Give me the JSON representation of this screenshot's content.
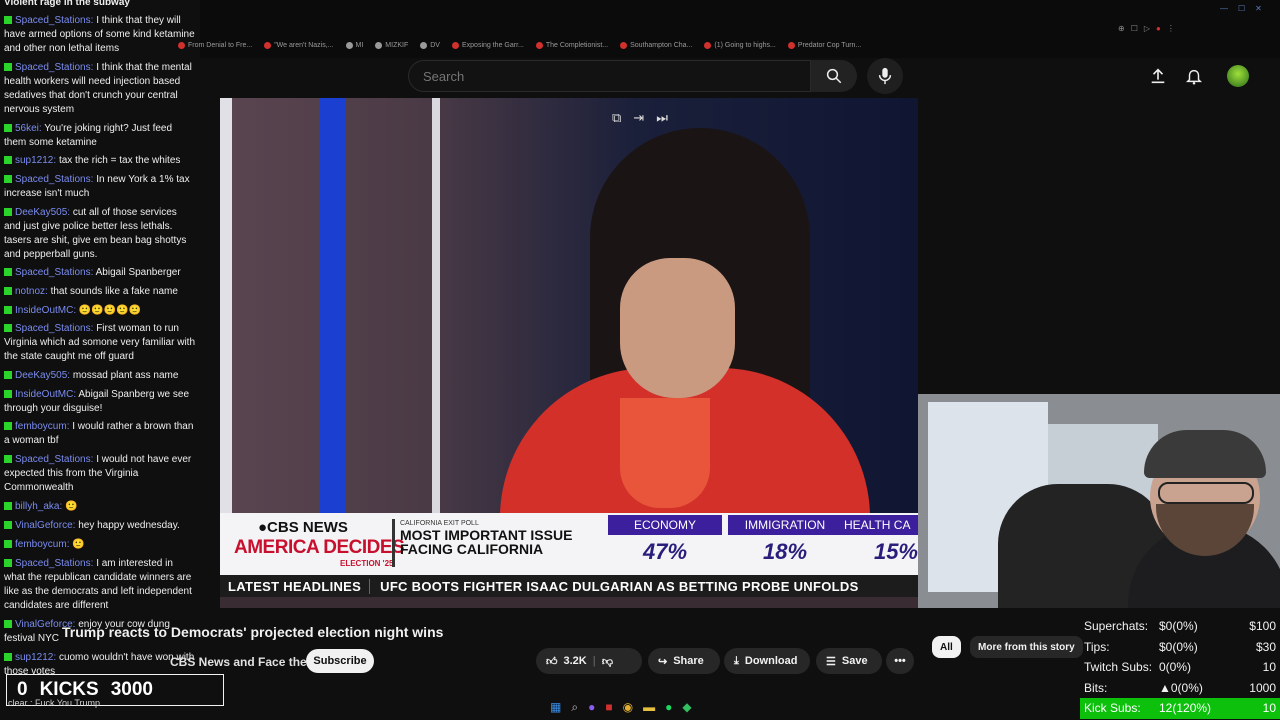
{
  "browser": {
    "bookmarks": [
      {
        "label": "From Denial to Fre...",
        "color": "#d0312d"
      },
      {
        "label": "\"We aren't Nazis,...",
        "color": "#d0312d"
      },
      {
        "label": "MI",
        "color": "#9a9a9a"
      },
      {
        "label": "MIZKIF",
        "color": "#9a9a9a"
      },
      {
        "label": "DV",
        "color": "#9a9a9a"
      },
      {
        "label": "Exposing the Garr...",
        "color": "#d0312d"
      },
      {
        "label": "The Completionist...",
        "color": "#d0312d"
      },
      {
        "label": "Southampton Cha...",
        "color": "#d0312d"
      },
      {
        "label": "(1) Going to highs...",
        "color": "#d0312d"
      },
      {
        "label": "Predator Cop Turn...",
        "color": "#d0312d"
      }
    ]
  },
  "header": {
    "search_placeholder": "Search",
    "icons": [
      "search-icon",
      "mic-icon",
      "upload-icon",
      "bell-icon",
      "avatar"
    ]
  },
  "video": {
    "overlay_controls": [
      "⧉",
      "⇥",
      "⏭"
    ],
    "cbs_logo": "●CBS NEWS",
    "america_decides": "AMERICA DECIDES",
    "election_tag": "ELECTION '25",
    "poll_label": "CALIFORNIA EXIT POLL",
    "poll_title": "MOST IMPORTANT ISSUE FACING CALIFORNIA",
    "poll": [
      {
        "category": "ECONOMY",
        "value": "47%"
      },
      {
        "category": "IMMIGRATION",
        "value": "18%"
      },
      {
        "category": "HEALTH CA",
        "value": "15%"
      }
    ],
    "ticker_label": "LATEST HEADLINES",
    "ticker_text": "UFC BOOTS FIGHTER ISAAC DULGARIAN AS BETTING PROBE UNFOLDS"
  },
  "meta": {
    "title": "Trump reacts to Democrats' projected election night wins",
    "channel": "CBS News and Face the Nation",
    "subscribe": "Subscribe",
    "likes": "3.2K",
    "share": "Share",
    "download": "Download",
    "save": "Save",
    "more": "•••",
    "chips": [
      "All",
      "More from this story"
    ]
  },
  "stats": [
    {
      "name": "Superchats:",
      "mid": "$0(0%)",
      "val": "$100"
    },
    {
      "name": "Tips:",
      "mid": "$0(0%)",
      "val": "$30"
    },
    {
      "name": "Twitch Subs:",
      "mid": "0(0%)",
      "val": "10"
    },
    {
      "name": "Bits:",
      "mid": "▲0(0%)",
      "val": "1000"
    },
    {
      "name": "Kick Subs:",
      "mid": "12(120%)",
      "val": "10"
    }
  ],
  "chat": {
    "top_line": "Violent rage in the subway",
    "messages": [
      {
        "user": "Spaced_Stations",
        "text": "I think that they will have armed options of some kind ketamine and other non lethal items"
      },
      {
        "user": "Spaced_Stations",
        "text": "I think that the mental health workers will need injection based sedatives that don't crunch your central nervous system"
      },
      {
        "user": "56kei",
        "text": "You're joking right? Just feed them some ketamine"
      },
      {
        "user": "sup1212",
        "text": "tax the rich = tax the whites"
      },
      {
        "user": "Spaced_Stations",
        "text": "In new York a 1% tax increase isn't much"
      },
      {
        "user": "DeeKay505",
        "text": "cut all of those services and just give police better less lethals. tasers are shit, give em bean bag shottys and pepperball guns."
      },
      {
        "user": "Spaced_Stations",
        "text": "Abigail Spanberger"
      },
      {
        "user": "notnoz",
        "text": "that sounds like a fake name"
      },
      {
        "user": "InsideOutMC",
        "text": "🙂🙂🙂🙂🙂"
      },
      {
        "user": "Spaced_Stations",
        "text": "First woman to run Virginia which ad somone very familiar with the state caught me off guard"
      },
      {
        "user": "DeeKay505",
        "text": "mossad plant ass name"
      },
      {
        "user": "InsideOutMC",
        "text": "Abigail Spanberg we see through your disguise!"
      },
      {
        "user": "femboycum",
        "text": "I would rather a brown than a woman tbf"
      },
      {
        "user": "Spaced_Stations",
        "text": "I would not have ever expected this from the Virginia Commonwealth"
      },
      {
        "user": "billyh_aka",
        "text": "🙂"
      },
      {
        "user": "VinalGeforce",
        "text": "hey happy wednesday."
      },
      {
        "user": "femboycum",
        "text": "🙂"
      },
      {
        "user": "Spaced_Stations",
        "text": "I am interested in what the republican candidate winners are like as the democrats and left independent candidates are different"
      },
      {
        "user": "VinalGeforce",
        "text": "enjoy your cow dung festival NYC"
      },
      {
        "user": "sup1212",
        "text": "cuomo wouldn't have won with those votes"
      }
    ]
  },
  "kicks": {
    "count": "0",
    "label": "KICKS",
    "goal": "3000"
  },
  "last_kick": "clear : Fuck You Trump"
}
